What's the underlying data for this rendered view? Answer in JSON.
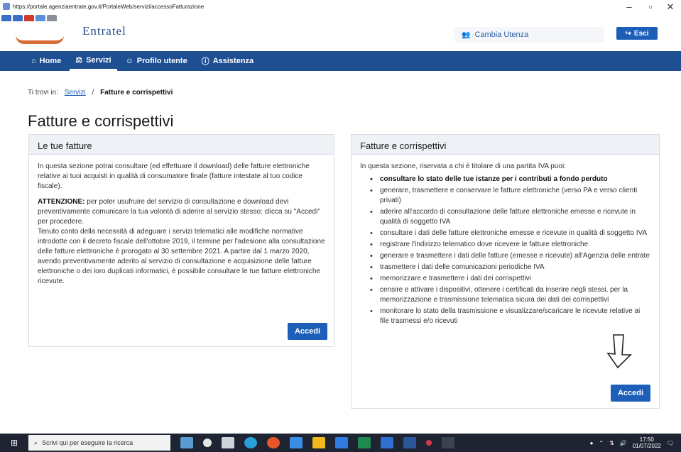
{
  "browser": {
    "url": "https://portale.agenziaentrate.gov.it/PortaleWeb/servizi/accessoFatturazione",
    "minimize": "–",
    "maximize": "▫",
    "close": "✕"
  },
  "header": {
    "logo_text": "Entratel",
    "cambia_utenza": "Cambia Utenza",
    "esci": "Esci"
  },
  "nav": {
    "items": [
      {
        "label": "Home",
        "icon": "home-icon"
      },
      {
        "label": "Servizi",
        "icon": "handshake-icon"
      },
      {
        "label": "Profilo utente",
        "icon": "user-icon"
      },
      {
        "label": "Assistenza",
        "icon": "info-icon"
      }
    ]
  },
  "breadcrumb": {
    "prefix": "Ti trovi in:",
    "link": "Servizi",
    "separator": "/",
    "current": "Fatture e corrispettivi"
  },
  "page_title": "Fatture e corrispettivi",
  "left_card": {
    "title": "Le tue fatture",
    "p1": "In questa sezione potrai consultare (ed effettuare il download) delle fatture elettroniche relative ai tuoi acquisti in qualità di consumatore finale (fatture intestate al tuo codice fiscale).",
    "attention_label": "ATTENZIONE:",
    "p2": " per poter usufruire del servizio di consultazione e download devi preventivamente comunicare la tua volontà di aderire al servizio stesso: clicca su \"Accedi\" per procedere.",
    "p3": "Tenuto conto della necessità di adeguare i servizi telematici alle modifiche normative introdotte con il decreto fiscale dell'ottobre 2019, il termine per l'adesione alla consultazione delle fatture elettroniche è prorogato al 30 settembre 2021. A partire dal 1 marzo 2020, avendo preventivamente aderito al servizio di consultazione e acquisizione delle fatture elettroniche o dei loro duplicati informatici, è possibile consultare le tue fatture elettroniche ricevute.",
    "button": "Accedi"
  },
  "right_card": {
    "title": "Fatture e corrispettivi",
    "intro": "In questa sezione, riservata a chi è titolare di una partita IVA puoi:",
    "items": [
      "consultare lo stato delle tue istanze per i contributi a fondo perduto",
      "generare, trasmettere e conservare le fatture elettroniche (verso PA e verso clienti privati)",
      "aderire all'accordo di consultazione delle fatture elettroniche emesse e ricevute in qualità di soggetto IVA",
      "consultare i dati delle fatture elettroniche emesse e ricevute in qualità di soggetto IVA",
      "registrare l'indirizzo telematico dove ricevere le fatture elettroniche",
      "generare e trasmettere i dati delle fatture (emesse e ricevute) all'Agenzia delle entrate",
      "trasmettere i dati delle comunicazioni periodiche IVA",
      "memorizzare e trasmettere i dati dei corrispettivi",
      "censire e attivare i dispositivi, ottenere i certificati da inserire negli stessi, per la memorizzazione e trasmissione telematica sicura dei dati dei corrispettivi",
      "monitorare lo stato della trasmissione e visualizzare/scaricare le ricevute relative ai file trasmessi e/o ricevuti"
    ],
    "button": "Accedi"
  },
  "taskbar": {
    "search_placeholder": "Scrivi qui per eseguire la ricerca",
    "time": "17:50",
    "date": "01/07/2022"
  }
}
